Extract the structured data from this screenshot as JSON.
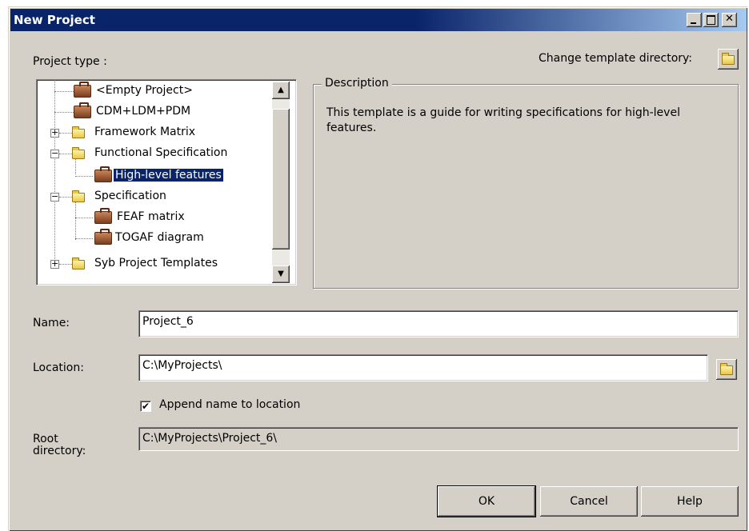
{
  "window": {
    "title": "New Project"
  },
  "project_type": {
    "label": "Project type :",
    "change_template_label": "Change template directory:",
    "tree": [
      {
        "label": "<Empty Project>",
        "icon": "briefcase-icon"
      },
      {
        "label": "CDM+LDM+PDM",
        "icon": "briefcase-icon"
      },
      {
        "label": "Framework Matrix",
        "icon": "folder-icon",
        "expander": "+"
      },
      {
        "label": "Functional Specification",
        "icon": "folder-icon",
        "expander": "−"
      },
      {
        "label": "High-level features",
        "icon": "briefcase-icon",
        "selected": true
      },
      {
        "label": "Specification",
        "icon": "folder-icon",
        "expander": "−"
      },
      {
        "label": "FEAF matrix",
        "icon": "briefcase-icon"
      },
      {
        "label": "TOGAF diagram",
        "icon": "briefcase-icon"
      },
      {
        "label": "Syb Project Templates",
        "icon": "folder-icon",
        "expander": "+"
      }
    ]
  },
  "description": {
    "legend": "Description",
    "text": "This template is a guide for writing specifications for high-level features."
  },
  "form": {
    "name_label": "Name:",
    "name_value": "Project_6",
    "location_label": "Location:",
    "location_value": "C:\\MyProjects\\",
    "append_label": "Append name to location",
    "append_checked": true,
    "root_label_1": "Root",
    "root_label_2": "directory:",
    "root_value": "C:\\MyProjects\\Project_6\\"
  },
  "buttons": {
    "ok": "OK",
    "cancel": "Cancel",
    "help": "Help"
  }
}
